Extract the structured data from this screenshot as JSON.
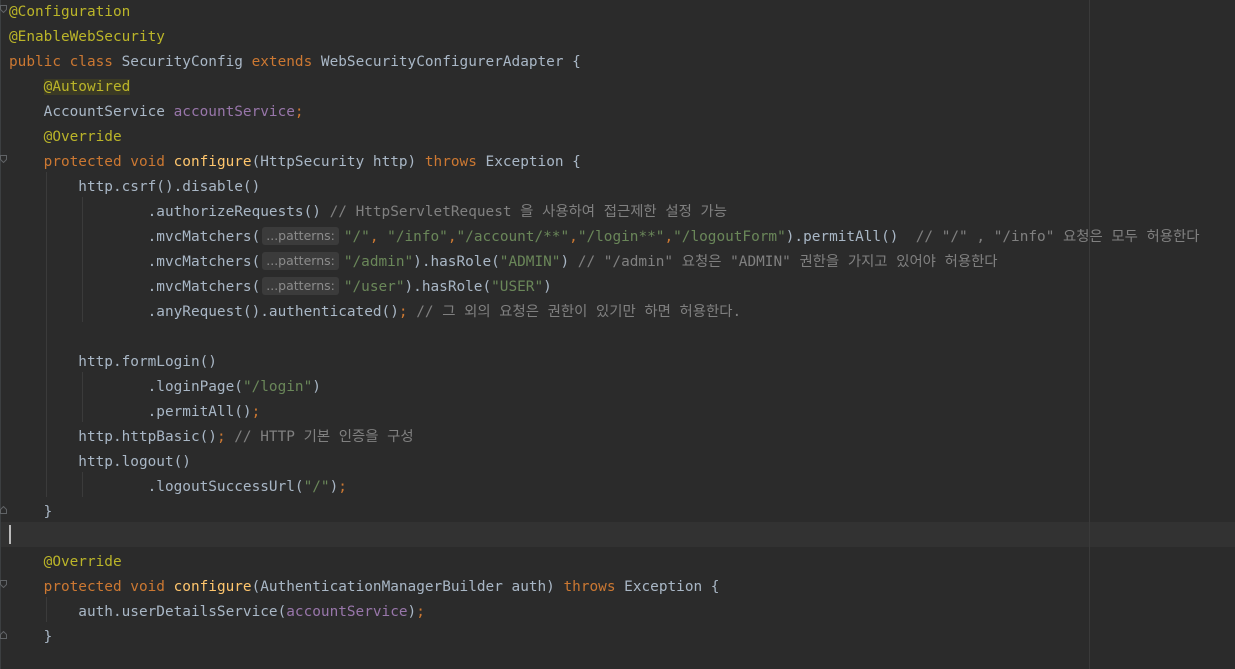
{
  "colors": {
    "background": "#2b2b2b",
    "keyword": "#cc7832",
    "annotation": "#bbb529",
    "method": "#ffc66d",
    "field": "#9876aa",
    "string": "#6a8759",
    "comment": "#808080",
    "text": "#a9b7c6"
  },
  "lines": [
    [
      {
        "t": "ann",
        "v": "@Configuration"
      }
    ],
    [
      {
        "t": "ann",
        "v": "@EnableWebSecurity"
      }
    ],
    [
      {
        "t": "kw",
        "v": "public class "
      },
      {
        "t": "plain",
        "v": "SecurityConfig "
      },
      {
        "t": "kw",
        "v": "extends "
      },
      {
        "t": "plain",
        "v": "WebSecurityConfigurerAdapter {"
      }
    ],
    [
      {
        "t": "plain",
        "v": "    "
      },
      {
        "t": "ann-hl",
        "v": "@Autowired"
      }
    ],
    [
      {
        "t": "plain",
        "v": "    AccountService "
      },
      {
        "t": "fld",
        "v": "accountService"
      },
      {
        "t": "kw",
        "v": ";"
      }
    ],
    [
      {
        "t": "plain",
        "v": "    "
      },
      {
        "t": "ann",
        "v": "@Override"
      }
    ],
    [
      {
        "t": "plain",
        "v": "    "
      },
      {
        "t": "kw",
        "v": "protected void "
      },
      {
        "t": "fn",
        "v": "configure"
      },
      {
        "t": "plain",
        "v": "(HttpSecurity http) "
      },
      {
        "t": "kw",
        "v": "throws "
      },
      {
        "t": "plain",
        "v": "Exception {"
      }
    ],
    [
      {
        "t": "plain",
        "v": "        http.csrf().disable()"
      }
    ],
    [
      {
        "t": "plain",
        "v": "                .authorizeRequests() "
      },
      {
        "t": "cmt",
        "v": "// HttpServletRequest 을 사용하여 접근제한 설정 가능"
      }
    ],
    [
      {
        "t": "plain",
        "v": "                .mvcMatchers("
      },
      {
        "t": "hint",
        "v": "...patterns:"
      },
      {
        "t": "str",
        "v": "\"/\""
      },
      {
        "t": "kw",
        "v": ", "
      },
      {
        "t": "str",
        "v": "\"/info\""
      },
      {
        "t": "kw",
        "v": ","
      },
      {
        "t": "str",
        "v": "\"/account/**\""
      },
      {
        "t": "kw",
        "v": ","
      },
      {
        "t": "str",
        "v": "\"/login**\""
      },
      {
        "t": "kw",
        "v": ","
      },
      {
        "t": "str",
        "v": "\"/logoutForm\""
      },
      {
        "t": "plain",
        "v": ").permitAll()  "
      },
      {
        "t": "cmt",
        "v": "// \"/\" , \"/info\" 요청은 모두 허용한다"
      }
    ],
    [
      {
        "t": "plain",
        "v": "                .mvcMatchers("
      },
      {
        "t": "hint",
        "v": "...patterns:"
      },
      {
        "t": "str",
        "v": "\"/admin\""
      },
      {
        "t": "plain",
        "v": ").hasRole("
      },
      {
        "t": "str",
        "v": "\"ADMIN\""
      },
      {
        "t": "plain",
        "v": ") "
      },
      {
        "t": "cmt",
        "v": "// \"/admin\" 요청은 \"ADMIN\" 권한을 가지고 있어야 허용한다"
      }
    ],
    [
      {
        "t": "plain",
        "v": "                .mvcMatchers("
      },
      {
        "t": "hint",
        "v": "...patterns:"
      },
      {
        "t": "str",
        "v": "\"/user\""
      },
      {
        "t": "plain",
        "v": ").hasRole("
      },
      {
        "t": "str",
        "v": "\"USER\""
      },
      {
        "t": "plain",
        "v": ")"
      }
    ],
    [
      {
        "t": "plain",
        "v": "                .anyRequest().authenticated()"
      },
      {
        "t": "kw",
        "v": "; "
      },
      {
        "t": "cmt",
        "v": "// 그 외의 요청은 권한이 있기만 하면 허용한다."
      }
    ],
    [],
    [
      {
        "t": "plain",
        "v": "        http.formLogin()"
      }
    ],
    [
      {
        "t": "plain",
        "v": "                .loginPage("
      },
      {
        "t": "str",
        "v": "\"/login\""
      },
      {
        "t": "plain",
        "v": ")"
      }
    ],
    [
      {
        "t": "plain",
        "v": "                .permitAll()"
      },
      {
        "t": "kw",
        "v": ";"
      }
    ],
    [
      {
        "t": "plain",
        "v": "        http.httpBasic()"
      },
      {
        "t": "kw",
        "v": "; "
      },
      {
        "t": "cmt",
        "v": "// HTTP 기본 인증을 구성"
      }
    ],
    [
      {
        "t": "plain",
        "v": "        http.logout()"
      }
    ],
    [
      {
        "t": "plain",
        "v": "                .logoutSuccessUrl("
      },
      {
        "t": "str",
        "v": "\"/\""
      },
      {
        "t": "plain",
        "v": ")"
      },
      {
        "t": "kw",
        "v": ";"
      }
    ],
    [
      {
        "t": "plain",
        "v": "    }"
      }
    ],
    [],
    [
      {
        "t": "plain",
        "v": "    "
      },
      {
        "t": "ann",
        "v": "@Override"
      }
    ],
    [
      {
        "t": "plain",
        "v": "    "
      },
      {
        "t": "kw",
        "v": "protected void "
      },
      {
        "t": "fn",
        "v": "configure"
      },
      {
        "t": "plain",
        "v": "(AuthenticationManagerBuilder auth) "
      },
      {
        "t": "kw",
        "v": "throws "
      },
      {
        "t": "plain",
        "v": "Exception {"
      }
    ],
    [
      {
        "t": "plain",
        "v": "        auth.userDetailsService("
      },
      {
        "t": "fld",
        "v": "accountService"
      },
      {
        "t": "plain",
        "v": ")"
      },
      {
        "t": "kw",
        "v": ";"
      }
    ],
    [
      {
        "t": "plain",
        "v": "    }"
      }
    ]
  ]
}
